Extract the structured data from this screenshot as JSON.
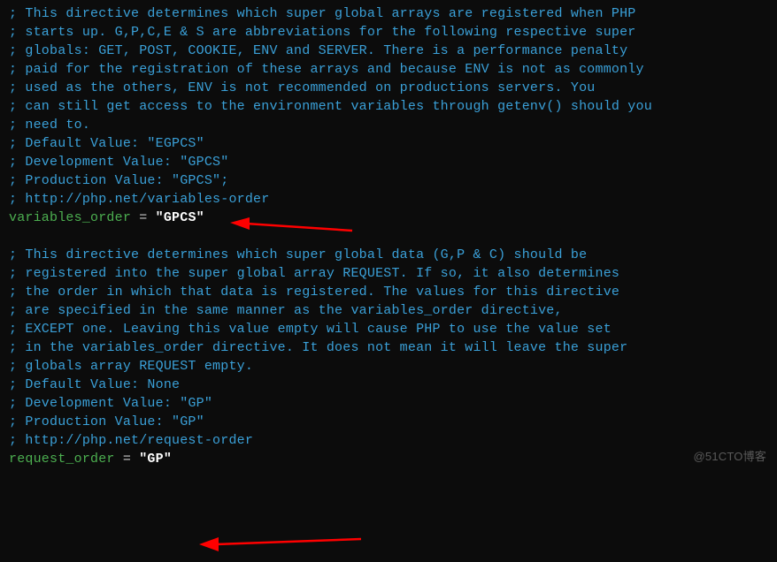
{
  "block1": {
    "c1": "; This directive determines which super global arrays are registered when PHP",
    "c2": "; starts up. G,P,C,E & S are abbreviations for the following respective super",
    "c3": "; globals: GET, POST, COOKIE, ENV and SERVER. There is a performance penalty",
    "c4": "; paid for the registration of these arrays and because ENV is not as commonly",
    "c5": "; used as the others, ENV is not recommended on productions servers. You",
    "c6": "; can still get access to the environment variables through getenv() should you",
    "c7": "; need to.",
    "c8": "; Default Value: \"EGPCS\"",
    "c9": "; Development Value: \"GPCS\"",
    "c10": "; Production Value: \"GPCS\";",
    "c11": "; http://php.net/variables-order",
    "key": "variables_order",
    "eq": " = ",
    "val": "\"GPCS\""
  },
  "block2": {
    "c1": "; This directive determines which super global data (G,P & C) should be",
    "c2": "; registered into the super global array REQUEST. If so, it also determines",
    "c3": "; the order in which that data is registered. The values for this directive",
    "c4": "; are specified in the same manner as the variables_order directive,",
    "c5": "; EXCEPT one. Leaving this value empty will cause PHP to use the value set",
    "c6": "; in the variables_order directive. It does not mean it will leave the super",
    "c7": "; globals array REQUEST empty.",
    "c8": "; Default Value: None",
    "c9": "; Development Value: \"GP\"",
    "c10": "; Production Value: \"GP\"",
    "c11": "; http://php.net/request-order",
    "key": "request_order",
    "eq": " = ",
    "val": "\"GP\""
  },
  "watermark": "@51CTO博客"
}
